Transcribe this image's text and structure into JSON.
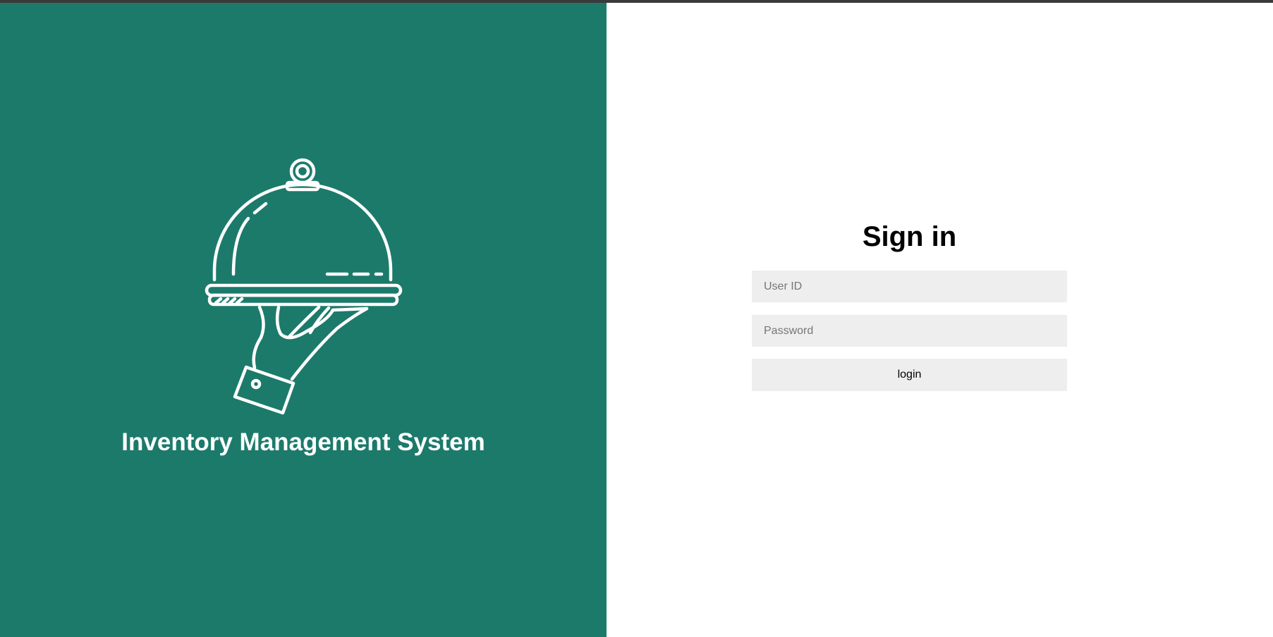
{
  "app": {
    "title": "Inventory Management System",
    "logo_icon": "serving-cloche-hand-icon"
  },
  "signin": {
    "title": "Sign in",
    "user_id_placeholder": "User ID",
    "user_id_value": "",
    "password_placeholder": "Password",
    "password_value": "",
    "login_label": "login"
  },
  "colors": {
    "left_panel_bg": "#1c7a6b",
    "right_panel_bg": "#ffffff",
    "field_bg": "#eeeeee",
    "top_bar": "#3a3a3a"
  }
}
